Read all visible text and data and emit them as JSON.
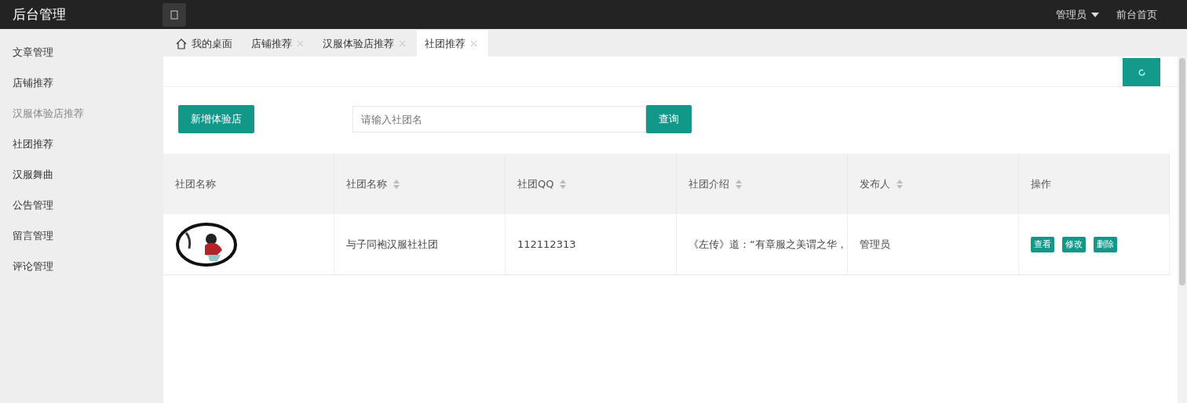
{
  "header": {
    "title": "后台管理",
    "user": "管理员",
    "home_link": "前台首页"
  },
  "sidebar": {
    "items": [
      {
        "label": "文章管理",
        "selected": false
      },
      {
        "label": "店铺推荐",
        "selected": false
      },
      {
        "label": "汉服体验店推荐",
        "selected": true
      },
      {
        "label": "社团推荐",
        "selected": false
      },
      {
        "label": "汉服舞曲",
        "selected": false
      },
      {
        "label": "公告管理",
        "selected": false
      },
      {
        "label": "留言管理",
        "selected": false
      },
      {
        "label": "评论管理",
        "selected": false
      }
    ]
  },
  "tabs": [
    {
      "label": "我的桌面",
      "kind": "home",
      "selected": false
    },
    {
      "label": "店铺推荐",
      "kind": "closable",
      "selected": false
    },
    {
      "label": "汉服体验店推荐",
      "kind": "closable",
      "selected": false
    },
    {
      "label": "社团推荐",
      "kind": "closable",
      "selected": true
    }
  ],
  "toolbar": {
    "add_button": "新增体验店",
    "search": {
      "placeholder": "请输入社团名"
    },
    "search_button": "查询"
  },
  "table": {
    "columns": [
      {
        "label": "社团名称",
        "sortable": false
      },
      {
        "label": "社团名称",
        "sortable": true
      },
      {
        "label": "社团QQ",
        "sortable": true
      },
      {
        "label": "社团介绍",
        "sortable": true
      },
      {
        "label": "发布人",
        "sortable": true
      },
      {
        "label": "操作",
        "sortable": false
      }
    ],
    "rows": [
      {
        "image": {
          "kind": "picture"
        },
        "name": "与子同袍汉服社社团",
        "qq": "112112313",
        "intro": "《左传》道：“有章服之美谓之华，",
        "publisher": "管理员",
        "actions": [
          "查看",
          "修改",
          "删除"
        ]
      }
    ]
  }
}
